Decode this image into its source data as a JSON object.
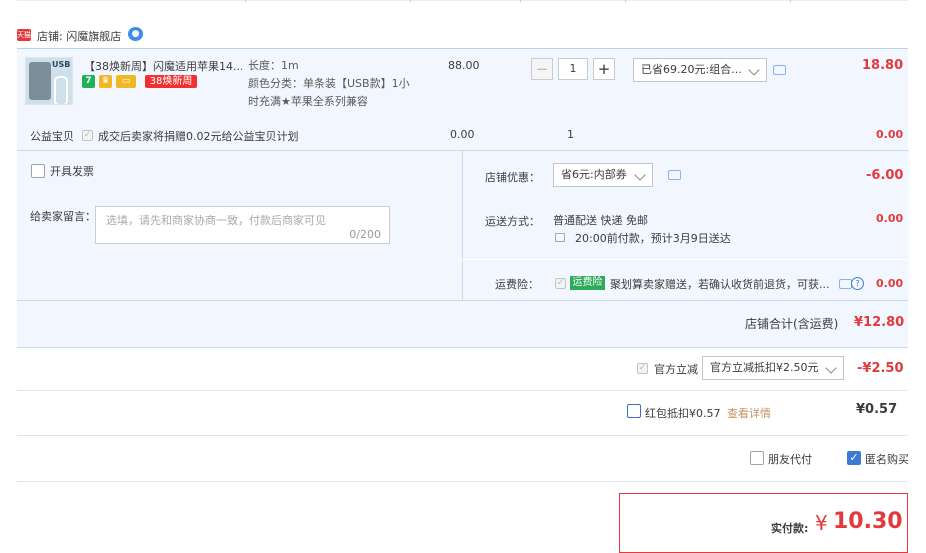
{
  "shop": {
    "badge": "天猫",
    "label": "店铺: 闪魔旗舰店",
    "chat_icon": "message-bubble-icon"
  },
  "item": {
    "title": "【38焕新周】闪魔适用苹果14...",
    "thumb_text": "USB",
    "icons": [
      "7",
      "shield-icon",
      "card-icon"
    ],
    "tag": "38焕新周",
    "attr_length": "长度：1m",
    "attr_color_1": "颜色分类：单条装【USB款】1小",
    "attr_color_2": "时充满★苹果全系列兼容",
    "price": "88.00",
    "qty_minus": "−",
    "qty": "1",
    "qty_plus": "+",
    "discount_select": "已省69.20元:组合...",
    "subtotal": "18.80"
  },
  "charity": {
    "label": "公益宝贝",
    "desc": "成交后卖家将捐赠0.02元给公益宝贝计划",
    "price": "0.00",
    "qty": "1",
    "subtotal": "0.00"
  },
  "invoice": {
    "label": "开具发票"
  },
  "message": {
    "label": "给卖家留言：",
    "placeholder": "选填，请先和商家协商一致，付款后商家可见",
    "counter": "0/200"
  },
  "shop_discount": {
    "label": "店铺优惠：",
    "value": "省6元:内部券",
    "amount": "-6.00"
  },
  "shipping": {
    "label": "运送方式：",
    "method": "普通配送 快递 免邮",
    "eta": "20:00前付款，预计3月9日送达",
    "amount": "0.00"
  },
  "insurance": {
    "label": "运费险：",
    "badge": "运费险",
    "desc": "聚划算卖家赠送，若确认收货前退货，可获...",
    "amount": "0.00"
  },
  "shop_total": {
    "label": "店铺合计(含运费)",
    "value": "¥12.80"
  },
  "official": {
    "label": "官方立减",
    "select": "官方立减抵扣¥2.50元",
    "amount": "-¥2.50"
  },
  "hongbao": {
    "label": "红包抵扣¥0.57",
    "link": "查看详情",
    "amount": "¥0.57"
  },
  "options": {
    "friend_pay": "朋友代付",
    "anonymous": "匿名购买"
  },
  "pay": {
    "label": "实付款:",
    "currency": "¥",
    "value": "10.30"
  },
  "colors": {
    "accent_red": "#e4393c",
    "panel_blue": "#f2f7ff",
    "check_blue": "#3a7bd5"
  }
}
